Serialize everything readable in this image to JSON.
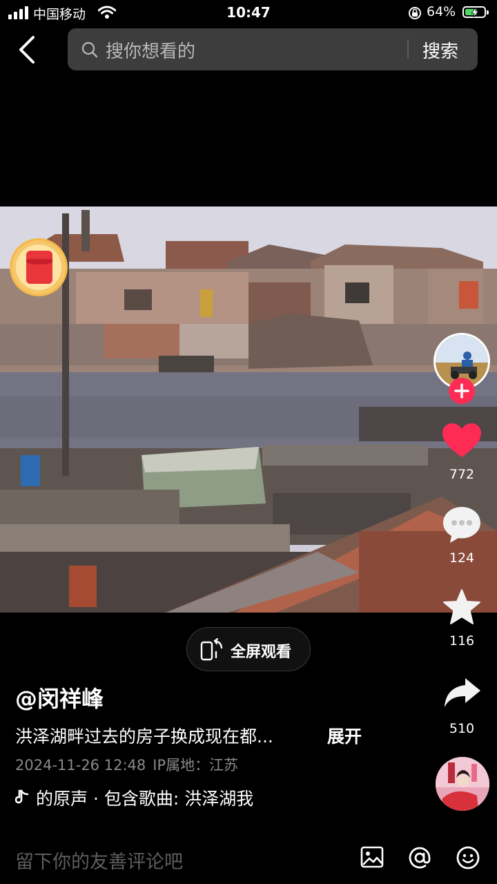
{
  "status_bar": {
    "carrier": "中国移动",
    "time": "10:47",
    "battery_percent": "64%",
    "battery_level": 0.64,
    "icons": [
      "signal-icon",
      "wifi-icon",
      "orientation-lock-icon",
      "battery-charging-icon"
    ]
  },
  "top_bar": {
    "back_icon": "chevron-left-icon",
    "search_placeholder": "搜你想看的",
    "search_button": "搜索"
  },
  "video": {
    "description": "洪泽湖畔过去的房子换成现在都...",
    "expand_label": "展开"
  },
  "fullscreen_button": {
    "label": "全屏观看",
    "icon": "rotate-screen-icon"
  },
  "right_column": {
    "like_count": "772",
    "comment_count": "124",
    "favorite_count": "116",
    "share_count": "510"
  },
  "info": {
    "author": "@闵祥峰",
    "date": "2024-11-26 12:48",
    "ip_location": "IP属地：江苏",
    "music_text": "的原声 · 包含歌曲: 洪泽湖我"
  },
  "comment_bar": {
    "placeholder": "留下你的友善评论吧",
    "icons": [
      "image-icon",
      "at-icon",
      "emoji-icon"
    ]
  },
  "colors": {
    "background": "#000000",
    "accent_red": "#fe2c55",
    "search_bg": "#3d3d3d",
    "battery_green": "#4cd964"
  }
}
